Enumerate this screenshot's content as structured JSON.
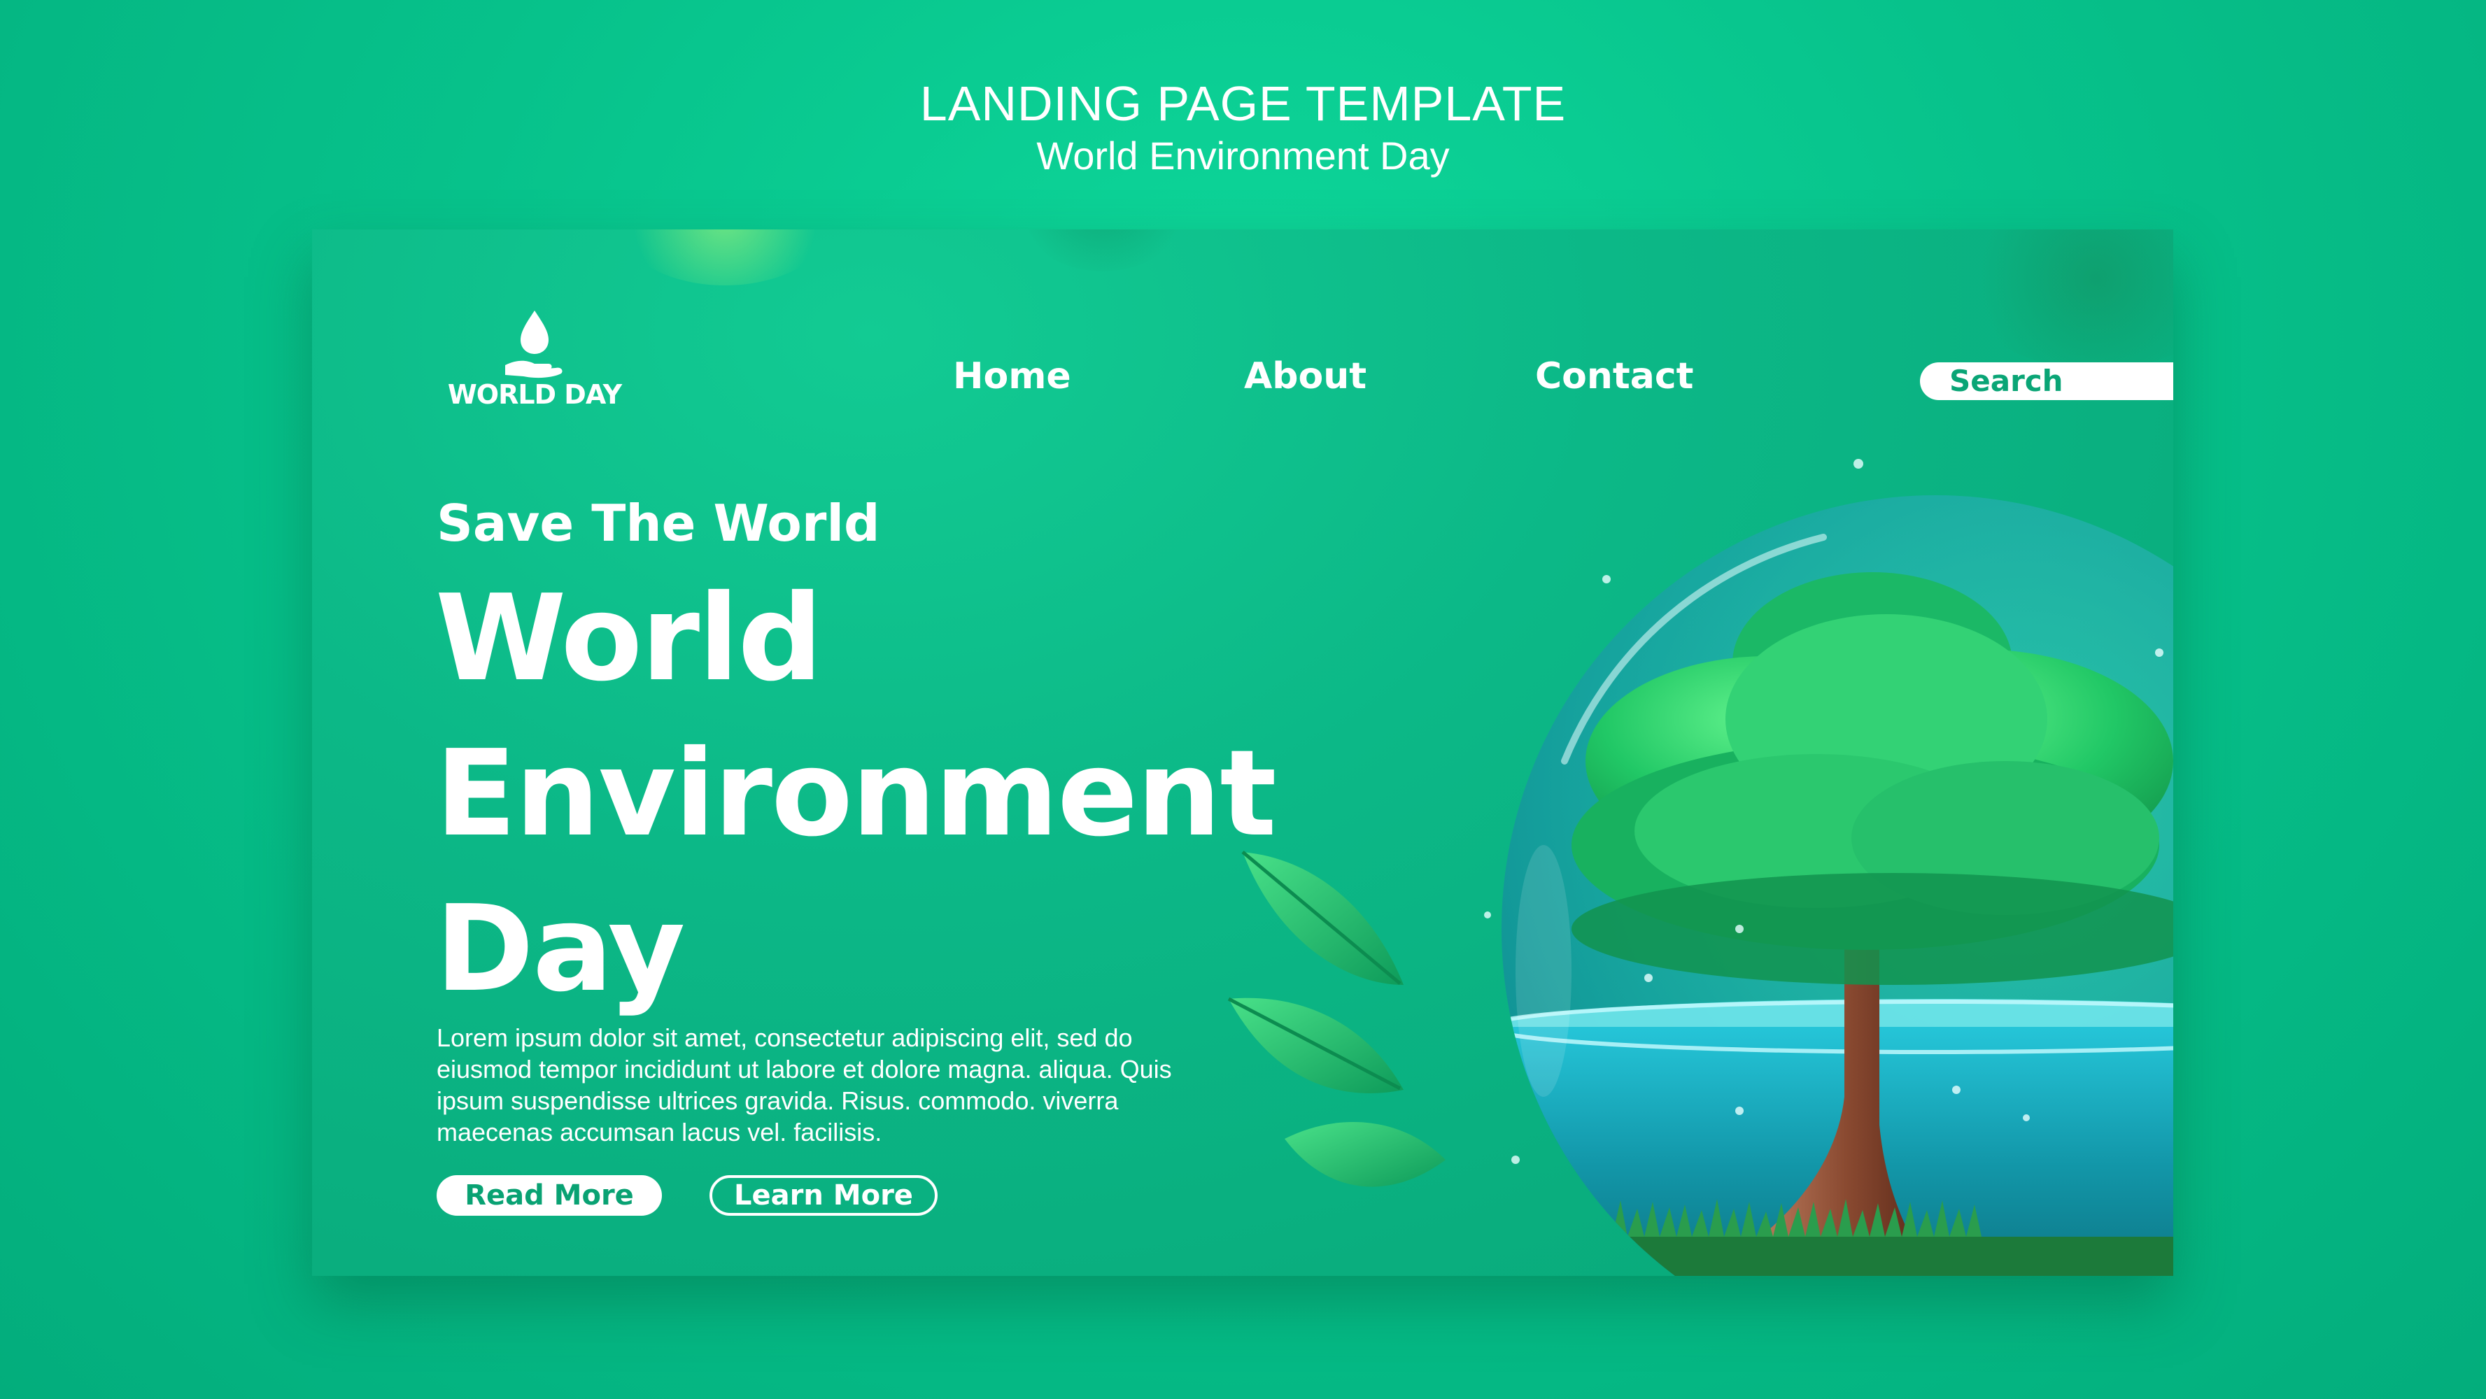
{
  "header": {
    "title": "LANDING PAGE TEMPLATE",
    "subtitle": "World Environment Day"
  },
  "logo": {
    "text": "WORLD DAY",
    "icon": "water-drop-hand-icon"
  },
  "nav": {
    "items": [
      {
        "label": "Home"
      },
      {
        "label": "About"
      },
      {
        "label": "Contact"
      }
    ],
    "search_label": "Search"
  },
  "hero": {
    "kicker": "Save The World",
    "title_lines": [
      "World",
      "Environment",
      "Day"
    ],
    "body": "Lorem ipsum dolor sit amet, consectetur adipiscing elit, sed do eiusmod tempor incididunt ut labore et dolore magna. aliqua. Quis ipsum suspendisse ultrices gravida. Risus. commodo. viverra maecenas accumsan lacus vel. facilisis.",
    "read_more": "Read More",
    "learn_more": "Learn More"
  },
  "illustration": {
    "globe-icon": "glass-sphere-with-tree",
    "leaf-icon": "green-leaves"
  },
  "colors": {
    "background": "#07c28b",
    "card": "#0cb887",
    "accent_text": "#0aa576",
    "white": "#ffffff"
  }
}
